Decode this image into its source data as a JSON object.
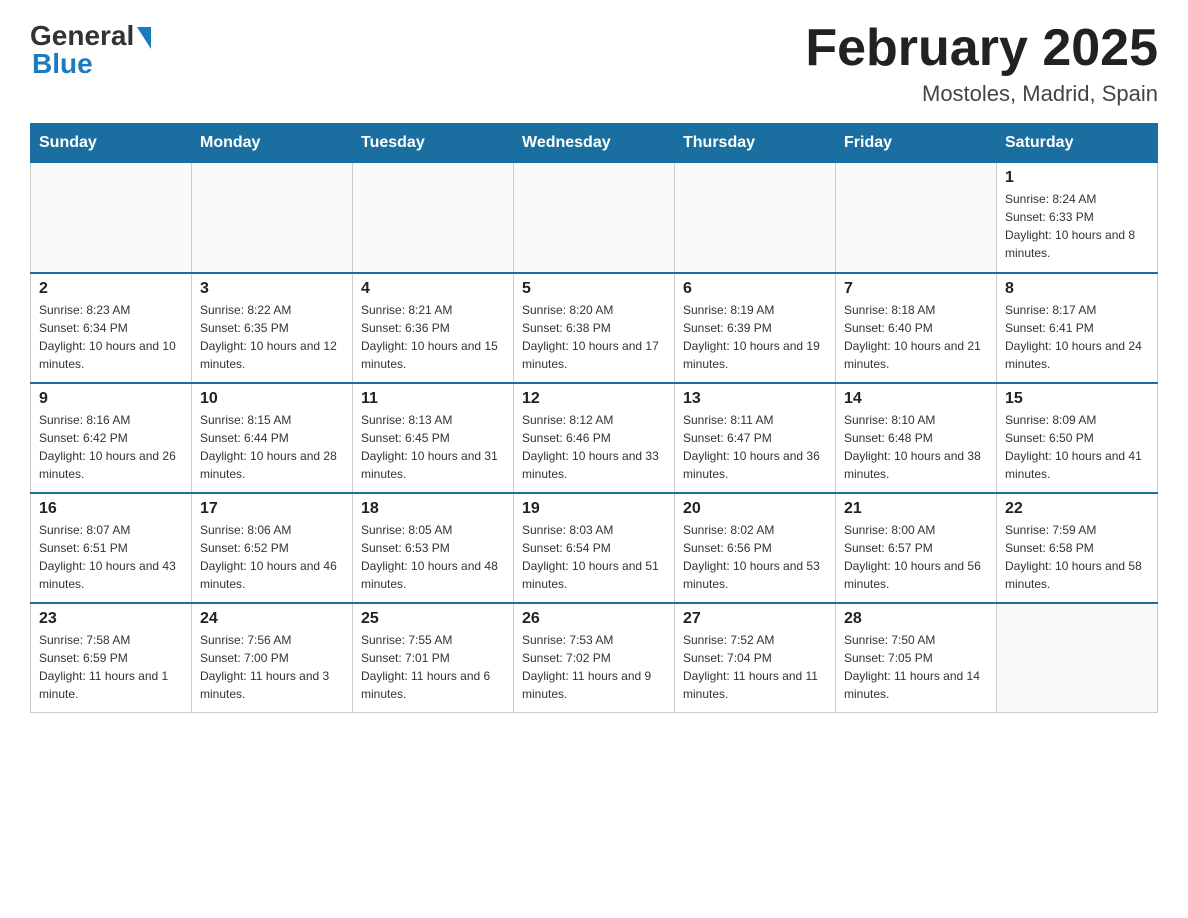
{
  "header": {
    "logo_general": "General",
    "logo_blue": "Blue",
    "month_title": "February 2025",
    "location": "Mostoles, Madrid, Spain"
  },
  "weekdays": [
    "Sunday",
    "Monday",
    "Tuesday",
    "Wednesday",
    "Thursday",
    "Friday",
    "Saturday"
  ],
  "weeks": [
    [
      {
        "day": "",
        "info": ""
      },
      {
        "day": "",
        "info": ""
      },
      {
        "day": "",
        "info": ""
      },
      {
        "day": "",
        "info": ""
      },
      {
        "day": "",
        "info": ""
      },
      {
        "day": "",
        "info": ""
      },
      {
        "day": "1",
        "info": "Sunrise: 8:24 AM\nSunset: 6:33 PM\nDaylight: 10 hours and 8 minutes."
      }
    ],
    [
      {
        "day": "2",
        "info": "Sunrise: 8:23 AM\nSunset: 6:34 PM\nDaylight: 10 hours and 10 minutes."
      },
      {
        "day": "3",
        "info": "Sunrise: 8:22 AM\nSunset: 6:35 PM\nDaylight: 10 hours and 12 minutes."
      },
      {
        "day": "4",
        "info": "Sunrise: 8:21 AM\nSunset: 6:36 PM\nDaylight: 10 hours and 15 minutes."
      },
      {
        "day": "5",
        "info": "Sunrise: 8:20 AM\nSunset: 6:38 PM\nDaylight: 10 hours and 17 minutes."
      },
      {
        "day": "6",
        "info": "Sunrise: 8:19 AM\nSunset: 6:39 PM\nDaylight: 10 hours and 19 minutes."
      },
      {
        "day": "7",
        "info": "Sunrise: 8:18 AM\nSunset: 6:40 PM\nDaylight: 10 hours and 21 minutes."
      },
      {
        "day": "8",
        "info": "Sunrise: 8:17 AM\nSunset: 6:41 PM\nDaylight: 10 hours and 24 minutes."
      }
    ],
    [
      {
        "day": "9",
        "info": "Sunrise: 8:16 AM\nSunset: 6:42 PM\nDaylight: 10 hours and 26 minutes."
      },
      {
        "day": "10",
        "info": "Sunrise: 8:15 AM\nSunset: 6:44 PM\nDaylight: 10 hours and 28 minutes."
      },
      {
        "day": "11",
        "info": "Sunrise: 8:13 AM\nSunset: 6:45 PM\nDaylight: 10 hours and 31 minutes."
      },
      {
        "day": "12",
        "info": "Sunrise: 8:12 AM\nSunset: 6:46 PM\nDaylight: 10 hours and 33 minutes."
      },
      {
        "day": "13",
        "info": "Sunrise: 8:11 AM\nSunset: 6:47 PM\nDaylight: 10 hours and 36 minutes."
      },
      {
        "day": "14",
        "info": "Sunrise: 8:10 AM\nSunset: 6:48 PM\nDaylight: 10 hours and 38 minutes."
      },
      {
        "day": "15",
        "info": "Sunrise: 8:09 AM\nSunset: 6:50 PM\nDaylight: 10 hours and 41 minutes."
      }
    ],
    [
      {
        "day": "16",
        "info": "Sunrise: 8:07 AM\nSunset: 6:51 PM\nDaylight: 10 hours and 43 minutes."
      },
      {
        "day": "17",
        "info": "Sunrise: 8:06 AM\nSunset: 6:52 PM\nDaylight: 10 hours and 46 minutes."
      },
      {
        "day": "18",
        "info": "Sunrise: 8:05 AM\nSunset: 6:53 PM\nDaylight: 10 hours and 48 minutes."
      },
      {
        "day": "19",
        "info": "Sunrise: 8:03 AM\nSunset: 6:54 PM\nDaylight: 10 hours and 51 minutes."
      },
      {
        "day": "20",
        "info": "Sunrise: 8:02 AM\nSunset: 6:56 PM\nDaylight: 10 hours and 53 minutes."
      },
      {
        "day": "21",
        "info": "Sunrise: 8:00 AM\nSunset: 6:57 PM\nDaylight: 10 hours and 56 minutes."
      },
      {
        "day": "22",
        "info": "Sunrise: 7:59 AM\nSunset: 6:58 PM\nDaylight: 10 hours and 58 minutes."
      }
    ],
    [
      {
        "day": "23",
        "info": "Sunrise: 7:58 AM\nSunset: 6:59 PM\nDaylight: 11 hours and 1 minute."
      },
      {
        "day": "24",
        "info": "Sunrise: 7:56 AM\nSunset: 7:00 PM\nDaylight: 11 hours and 3 minutes."
      },
      {
        "day": "25",
        "info": "Sunrise: 7:55 AM\nSunset: 7:01 PM\nDaylight: 11 hours and 6 minutes."
      },
      {
        "day": "26",
        "info": "Sunrise: 7:53 AM\nSunset: 7:02 PM\nDaylight: 11 hours and 9 minutes."
      },
      {
        "day": "27",
        "info": "Sunrise: 7:52 AM\nSunset: 7:04 PM\nDaylight: 11 hours and 11 minutes."
      },
      {
        "day": "28",
        "info": "Sunrise: 7:50 AM\nSunset: 7:05 PM\nDaylight: 11 hours and 14 minutes."
      },
      {
        "day": "",
        "info": ""
      }
    ]
  ]
}
